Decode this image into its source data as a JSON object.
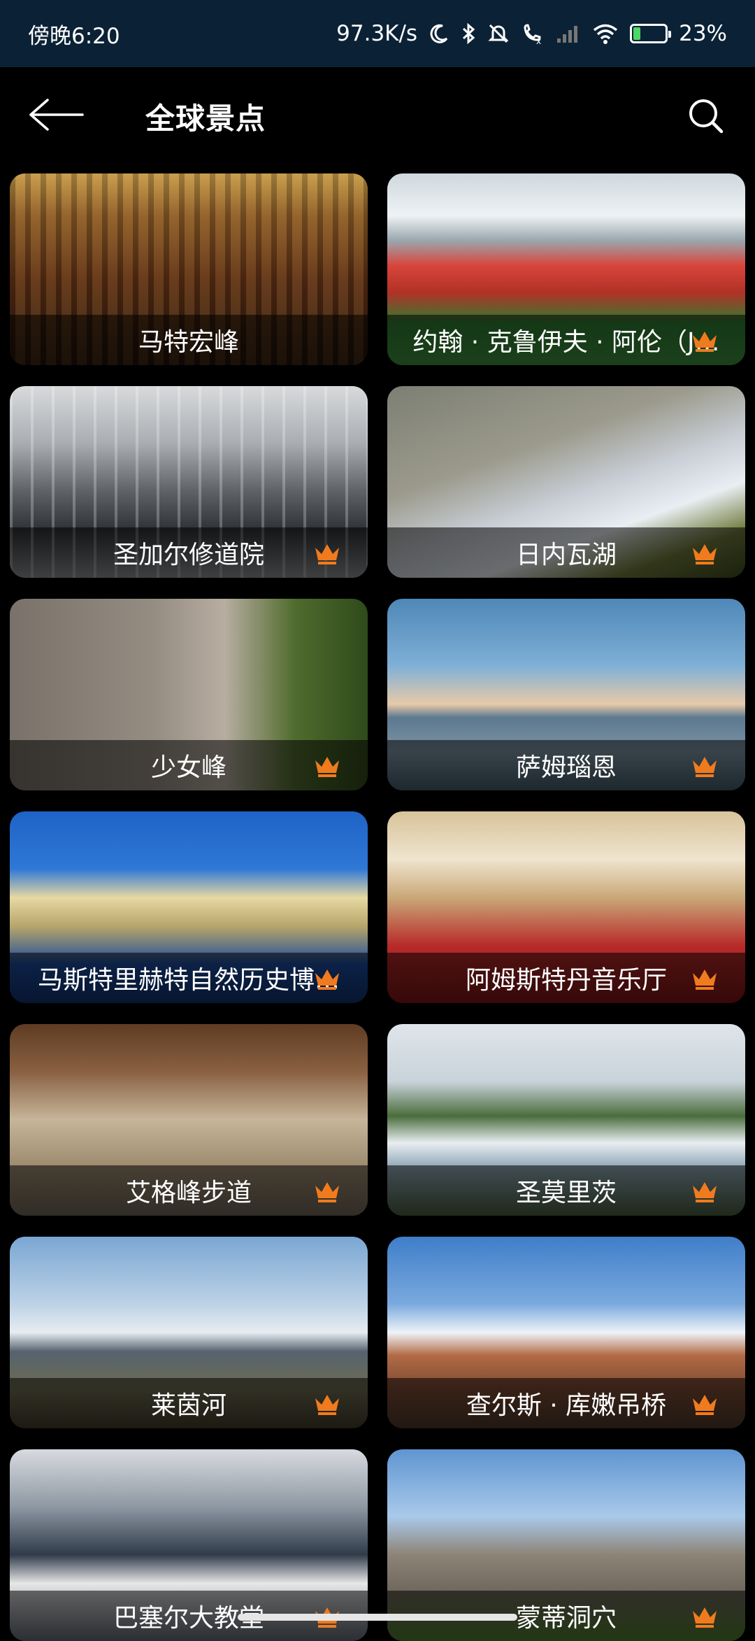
{
  "status_bar": {
    "time": "傍晚6:20",
    "net_speed": "97.3K/s",
    "battery_percent": "23%",
    "battery_level": 0.23,
    "icons": [
      "moon-icon",
      "bluetooth-icon",
      "mute-icon",
      "call-icon",
      "signal-icon",
      "wifi-icon",
      "battery-charging-icon"
    ]
  },
  "header": {
    "title": "全球景点",
    "back_icon": "arrow-left-icon",
    "search_icon": "search-icon"
  },
  "accent_color": "#f07b1e",
  "places": [
    {
      "name": "马特宏峰",
      "premium": false
    },
    {
      "name": "约翰 · 克鲁伊夫 · 阿伦（J…",
      "premium": true
    },
    {
      "name": "圣加尔修道院",
      "premium": true
    },
    {
      "name": "日内瓦湖",
      "premium": true
    },
    {
      "name": "少女峰",
      "premium": true
    },
    {
      "name": "萨姆瑙恩",
      "premium": true
    },
    {
      "name": "马斯特里赫特自然历史博…",
      "premium": true
    },
    {
      "name": "阿姆斯特丹音乐厅",
      "premium": true
    },
    {
      "name": "艾格峰步道",
      "premium": true
    },
    {
      "name": "圣莫里茨",
      "premium": true
    },
    {
      "name": "莱茵河",
      "premium": true
    },
    {
      "name": "查尔斯 · 库嫩吊桥",
      "premium": true
    },
    {
      "name": "巴塞尔大教堂",
      "premium": true
    },
    {
      "name": "蒙蒂洞穴",
      "premium": true
    }
  ]
}
